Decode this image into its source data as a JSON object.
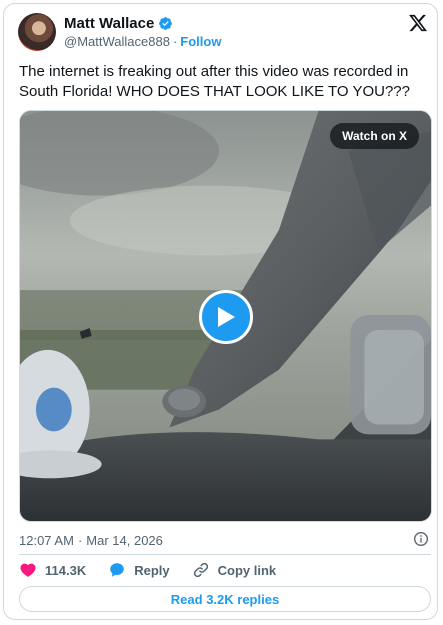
{
  "author": {
    "display_name": "Matt Wallace",
    "handle": "@MattWallace888",
    "separator": "·",
    "follow_label": "Follow"
  },
  "tweet": {
    "text": "The internet is freaking out after this video was recorded in South Florida! WHO DOES THAT LOOK LIKE TO YOU???"
  },
  "media": {
    "watch_label": "Watch on X"
  },
  "meta": {
    "time": "12:07 AM",
    "separator": "·",
    "date": "Mar 14, 2026"
  },
  "actions": {
    "like_count": "114.3K",
    "reply_label": "Reply",
    "copy_link_label": "Copy link"
  },
  "replies_button": "Read 3.2K replies",
  "colors": {
    "accent": "#1d9bf0",
    "like": "#f91880",
    "text": "#0f1419",
    "muted": "#536471",
    "border": "#cfd9de"
  },
  "icons": [
    "verified-badge-icon",
    "x-logo-icon",
    "play-icon",
    "info-icon",
    "heart-icon",
    "reply-bubble-icon",
    "link-icon"
  ]
}
